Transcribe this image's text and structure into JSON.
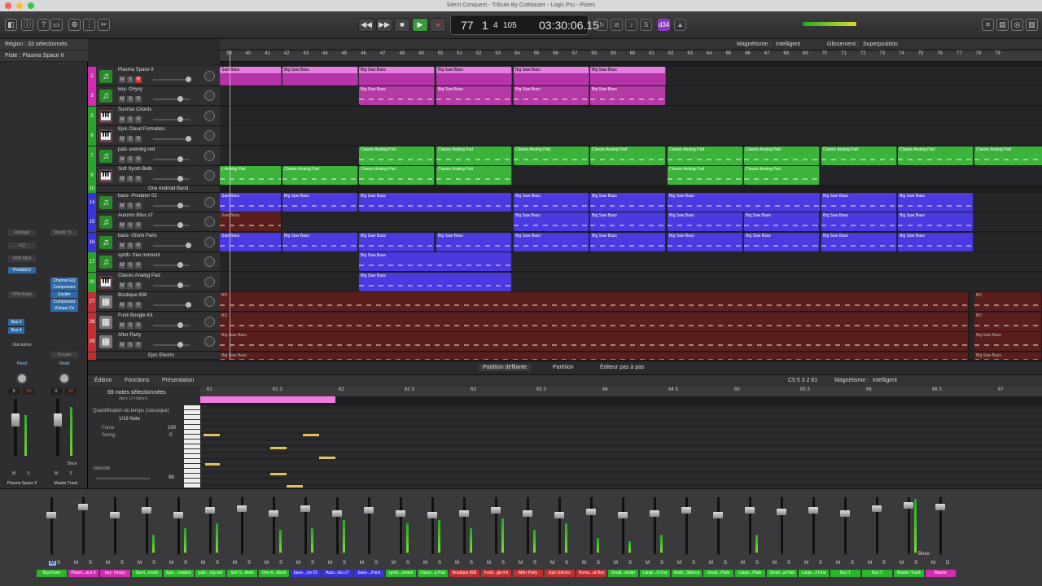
{
  "window_title": "Silent Conquest - Tribute By CutMaster - Logic Pro - Pistes",
  "lcd": {
    "bar": "77",
    "beat": "1",
    "div": "4",
    "tick": "105",
    "time": "03:30:06.15",
    "cpu": "d34"
  },
  "inspector": {
    "region_label": "Région : 33 sélectionnés",
    "track_label": "Piste : Plasma Space II",
    "setting": "Réglage",
    "eq": "EQ",
    "fpm_midi": "FPM MIDI",
    "fpm_audio": "FPM Audio",
    "plugin": "Predator2",
    "master_label": "Master Tr...",
    "fx": [
      "Channel EQ",
      "Compressor",
      "Exciter",
      "Compressor",
      "iZotope Oz"
    ],
    "bus3": "Bus 3",
    "bus4": "Bus 4",
    "out": "Out stéréo",
    "group": "Groupe",
    "read_left": "Read",
    "read_right": "Read",
    "vol_left": "0",
    "pan_left": "-26",
    "vol_right": "0",
    "pan_right": "02",
    "bnce": "Bnce",
    "m": "M",
    "s": "S",
    "strip_left": "Plasma Space II",
    "strip_right": "Master Track"
  },
  "menus": {
    "edit": "Édition",
    "functions": "Fonctions",
    "view": "Présentation",
    "snap_label": "Magnétisme :",
    "snap": "Intelligent",
    "drag_label": "Glissement :",
    "drag": "Superposition"
  },
  "tracks": [
    {
      "num": "2",
      "name": "Plasma Space II",
      "color": "#d02cb0",
      "icon": "synth"
    },
    {
      "num": "3",
      "name": "key- Onyxy",
      "color": "#d02cb0",
      "icon": "synth"
    },
    {
      "num": "5",
      "name": "Sunrise Chords",
      "color": "#29a329",
      "icon": "keyboard"
    },
    {
      "num": "6",
      "name": "Epic Cloud Formation",
      "color": "#29a329",
      "icon": "keyboard"
    },
    {
      "num": "7",
      "name": "pad- evening red",
      "color": "#29a329",
      "icon": "synth"
    },
    {
      "num": "9",
      "name": "Soft Synth Bells",
      "color": "#29a329",
      "icon": "keyboard"
    },
    {
      "num": "10",
      "name": "One Android Band",
      "color": "#29a329",
      "icon": "none"
    },
    {
      "num": "14",
      "name": "bass- Predator 02",
      "color": "#3a33d6",
      "icon": "synth"
    },
    {
      "num": "15",
      "name": "Autumn Bliss sT",
      "color": "#3a33d6",
      "icon": "synth"
    },
    {
      "num": "16",
      "name": "bass- Gfunk Paris",
      "color": "#3a33d6",
      "icon": "synth"
    },
    {
      "num": "17",
      "name": "synth- free moment",
      "color": "#29a329",
      "icon": "synth"
    },
    {
      "num": "20",
      "name": "Classic Analog Pad",
      "color": "#29a329",
      "icon": "keyboard"
    },
    {
      "num": "27",
      "name": "Boutique 808",
      "color": "#c03030",
      "icon": "drum"
    },
    {
      "num": "28",
      "name": "Funk Boogie Kit",
      "color": "#c03030",
      "icon": "drum"
    },
    {
      "num": "29",
      "name": "After Party",
      "color": "#c03030",
      "icon": "drum"
    },
    {
      "num": "",
      "name": "Epic Electro",
      "color": "#c03030",
      "icon": "drum"
    }
  ],
  "ruler": [
    "39",
    "40",
    "41",
    "42",
    "43",
    "44",
    "45",
    "46",
    "47",
    "48",
    "49",
    "50",
    "51",
    "52",
    "53",
    "54",
    "55",
    "56",
    "57",
    "58",
    "59",
    "60",
    "61",
    "62",
    "63",
    "64",
    "65",
    "66",
    "67",
    "68",
    "69",
    "70",
    "71",
    "72",
    "73",
    "74",
    "75",
    "76",
    "77",
    "78",
    "79"
  ],
  "regions": {
    "big_saw_bass": "Big Saw Bass",
    "classic_analog_pad": "Classic Analog Pad",
    "saw_bass_short": "Saw Bass",
    "analog_pad_short": "c Analog Pad",
    "bd": "BD"
  },
  "editor_tabs": {
    "score": "Partition défilante",
    "partition": "Partition",
    "step": "Éditeur pas à pas"
  },
  "piano": {
    "notes_selected": "69 notes sélectionnées",
    "in_regions": "dans 14 régions",
    "quant_label": "Quantification du temps (classique)",
    "quant": "1/16 Note",
    "force_label": "Force",
    "force": "100",
    "swing_label": "Swing",
    "swing": "0",
    "velocity_label": "Vélocité",
    "velocity": "98",
    "pos": "C5  5 3 2 81",
    "snap_label": "Magnétisme :",
    "snap": "Intelligent",
    "ruler": [
      "61",
      "61 3",
      "62",
      "62 3",
      "63",
      "63 3",
      "64",
      "64 3",
      "65",
      "65 3",
      "66",
      "66 3",
      "67"
    ]
  },
  "mixer": [
    {
      "name": "Big Room",
      "color": "#2bb52b"
    },
    {
      "name": "Plasm...ace II",
      "color": "#d02cb0"
    },
    {
      "name": "key- Onyxy",
      "color": "#d02cb0"
    },
    {
      "name": "Sunri...hords",
      "color": "#2bb52b"
    },
    {
      "name": "Epic...rmation",
      "color": "#2bb52b"
    },
    {
      "name": "pad-...ing red",
      "color": "#2bb52b"
    },
    {
      "name": "Soft S...Bells",
      "color": "#2bb52b"
    },
    {
      "name": "One A...Band",
      "color": "#2bb52b"
    },
    {
      "name": "bass-...tor 02",
      "color": "#3a33d6"
    },
    {
      "name": "Autu...liss sT",
      "color": "#3a33d6"
    },
    {
      "name": "bass-...Paris",
      "color": "#3a33d6"
    },
    {
      "name": "synth...oment",
      "color": "#2bb52b"
    },
    {
      "name": "Classi...g Pad",
      "color": "#2bb52b"
    },
    {
      "name": "Boutique 808",
      "color": "#c03030"
    },
    {
      "name": "Funk...gie Kit",
      "color": "#c03030"
    },
    {
      "name": "After Party",
      "color": "#c03030"
    },
    {
      "name": "Epic Electro",
      "color": "#c03030"
    },
    {
      "name": "Huma...at Box",
      "color": "#c03030"
    },
    {
      "name": "Small...ander",
      "color": "#2bb52b"
    },
    {
      "name": "Large...ll One",
      "color": "#2bb52b"
    },
    {
      "name": "Ambi...Silence",
      "color": "#2bb52b"
    },
    {
      "name": "Small...Plate",
      "color": "#2bb52b"
    },
    {
      "name": "Large...Plate",
      "color": "#2bb52b"
    },
    {
      "name": "Small...al Hall",
      "color": "#2bb52b"
    },
    {
      "name": "Large...ll One",
      "color": "#2bb52b"
    },
    {
      "name": "Bus 1",
      "color": "#2bb52b"
    },
    {
      "name": "Bus 2",
      "color": "#2bb52b"
    },
    {
      "name": "Master Track",
      "color": "#2bb52b"
    },
    {
      "name": "Master",
      "color": "#d02cb0"
    }
  ],
  "mixer_labels": {
    "m": "M",
    "s": "S",
    "d": "D",
    "bnce": "Bnce"
  }
}
